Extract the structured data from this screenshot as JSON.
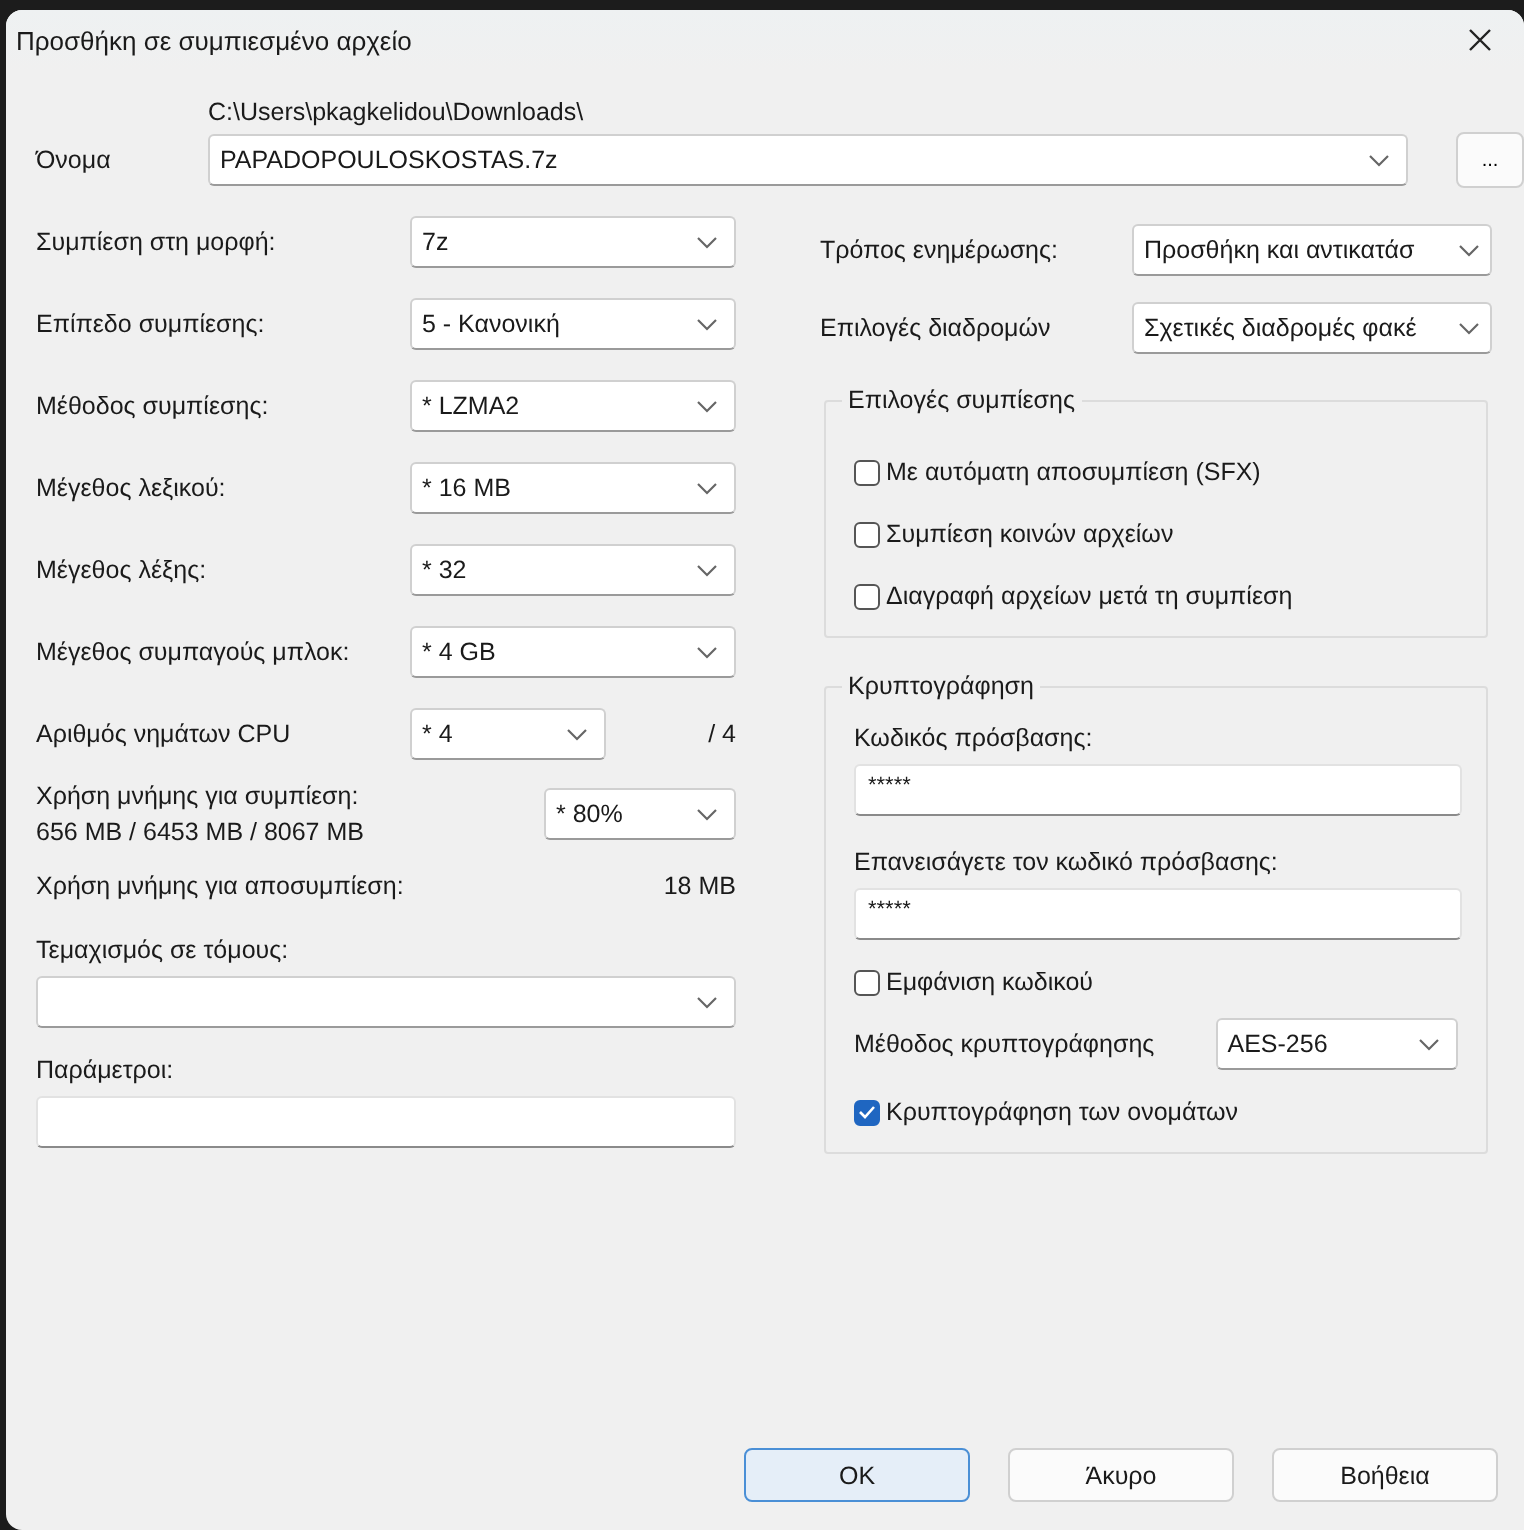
{
  "window": {
    "title": "Προσθήκη σε συμπιεσμένο αρχείο"
  },
  "archive": {
    "label": "Όνομα",
    "path": "C:\\Users\\pkagkelidou\\Downloads\\",
    "value": "PAPADOPOULOSKOSTAS.7z",
    "browse": "..."
  },
  "settings": [
    {
      "kind": "select",
      "label": "Συμπίεση στη μορφή:",
      "value": "7z"
    },
    {
      "kind": "select",
      "label": "Επίπεδο συμπίεσης:",
      "value": "5 - Κανονική"
    },
    {
      "kind": "select",
      "label": "Μέθοδος συμπίεσης:",
      "value": "*  LZMA2"
    },
    {
      "kind": "select",
      "label": "Μέγεθος λεξικού:",
      "value": "*  16 MB"
    },
    {
      "kind": "select",
      "label": "Μέγεθος λέξης:",
      "value": "*  32"
    },
    {
      "kind": "select",
      "label": "Μέγεθος συμπαγούς μπλοκ:",
      "value": "*  4 GB"
    },
    {
      "kind": "threads",
      "label": "Αριθμός νημάτων CPU",
      "value": "*  4",
      "total": "/ 4"
    },
    {
      "kind": "memory",
      "label": "Χρήση μνήμης για συμπίεση:",
      "detail": "656 MB / 6453 MB / 8067 MB",
      "value": "* 80%"
    },
    {
      "kind": "info",
      "label": "Χρήση μνήμης για αποσυμπίεση:",
      "value": "18 MB"
    }
  ],
  "volumes": {
    "label": "Τεμαχισμός σε τόμους:"
  },
  "parameters": {
    "label": "Παράμετροι:"
  },
  "update_mode": {
    "label": "Τρόπος ενημέρωσης:",
    "value": "Προσθήκη και αντικατάσ"
  },
  "path_mode": {
    "label": "Επιλογές διαδρομών",
    "value": "Σχετικές διαδρομές φακέ"
  },
  "options": {
    "title": "Επιλογές συμπίεσης",
    "items": [
      {
        "label": "Με αυτόματη αποσυμπίεση (SFX)",
        "checked": false
      },
      {
        "label": "Συμπίεση κοινών αρχείων",
        "checked": false
      },
      {
        "label": "Διαγραφή αρχείων μετά τη συμπίεση",
        "checked": false
      }
    ]
  },
  "encryption": {
    "title": "Κρυπτογράφηση",
    "password_label": "Κωδικός πρόσβασης:",
    "password": "*****",
    "repeat_label": "Επανεισάγετε τον κωδικό πρόσβασης:",
    "repeat": "*****",
    "show_password": {
      "label": "Εμφάνιση κωδικού",
      "checked": false
    },
    "method_label": "Μέθοδος κρυπτογράφησης",
    "method": "AES-256",
    "encrypt_names": {
      "label": "Κρυπτογράφηση των ονομάτων",
      "checked": true
    }
  },
  "buttons": [
    {
      "label": "OK",
      "default": true
    },
    {
      "label": "Άκυρο",
      "default": false
    },
    {
      "label": "Βοήθεια",
      "default": false
    }
  ]
}
